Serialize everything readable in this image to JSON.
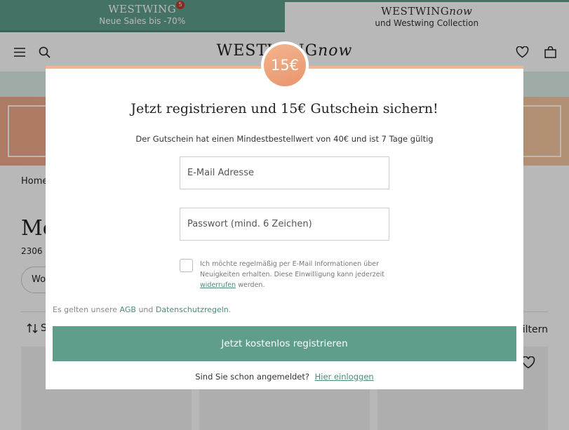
{
  "top_tabs": {
    "sales": {
      "brand": "WESTWING",
      "badge": "5",
      "subtitle": "Neue Sales bis -70%"
    },
    "now": {
      "brand": "WESTWING",
      "brand_suffix": "now",
      "subtitle": "und Westwing Collection"
    }
  },
  "header": {
    "logo": "WESTWING",
    "logo_suffix": "now",
    "icons": [
      "menu-icon",
      "search-icon",
      "heart-icon",
      "bag-icon"
    ]
  },
  "page": {
    "breadcrumb": "Home",
    "category_title": "Mö",
    "product_count": "2306 P",
    "chip_label": "Wo",
    "sort_label": "S",
    "filter_label": "iltern"
  },
  "modal": {
    "coupon": "15€",
    "title": "Jetzt registrieren und 15€ Gutschein sichern!",
    "subtitle": "Der Gutschein hat einen Mindestbestellwert von 40€ und ist 7 Tage gültig",
    "email_placeholder": "E-Mail Adresse",
    "password_placeholder": "Passwort (mind. 6 Zeichen)",
    "newsletter_text": "Ich möchte regelmäßig per E-Mail Informationen über Neuigkeiten erhalten. Diese Einwilligung kann jederzeit",
    "newsletter_link": "widerrufen",
    "newsletter_end": "werden.",
    "legal_prefix": "Es gelten unsere",
    "legal_agb": "AGB",
    "legal_and": "und",
    "legal_privacy": "Datenschutzregeln",
    "legal_dot": ".",
    "cta": "Jetzt kostenlos registrieren",
    "login_question": "Sind Sie schon angemeldet?",
    "login_link": "Hier einloggen"
  },
  "colors": {
    "accent": "#5f9e8c",
    "coupon": "#ee9f79",
    "promo": "#f0a98a"
  }
}
